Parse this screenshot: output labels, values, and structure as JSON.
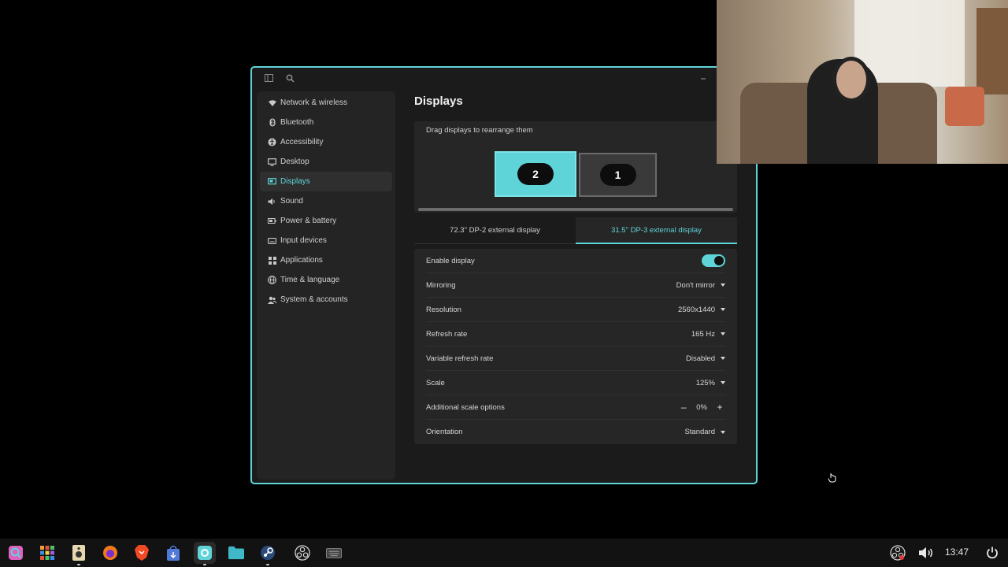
{
  "window": {
    "page_title": "Displays",
    "icons": {
      "sidebar_toggle": "sidebar-toggle-icon",
      "search": "search-icon",
      "minimize": "minimize-icon"
    }
  },
  "sidebar": {
    "items": [
      {
        "label": "Network & wireless",
        "icon": "wifi-icon"
      },
      {
        "label": "Bluetooth",
        "icon": "bluetooth-icon"
      },
      {
        "label": "Accessibility",
        "icon": "accessibility-icon"
      },
      {
        "label": "Desktop",
        "icon": "desktop-icon"
      },
      {
        "label": "Displays",
        "icon": "display-icon",
        "active": true
      },
      {
        "label": "Sound",
        "icon": "speaker-icon"
      },
      {
        "label": "Power & battery",
        "icon": "battery-icon"
      },
      {
        "label": "Input devices",
        "icon": "keyboard-icon"
      },
      {
        "label": "Applications",
        "icon": "apps-grid-icon"
      },
      {
        "label": "Time & language",
        "icon": "globe-icon"
      },
      {
        "label": "System & accounts",
        "icon": "users-icon"
      }
    ]
  },
  "arrange": {
    "hint": "Drag displays to rearrange them",
    "displays": [
      {
        "number": "2",
        "selected": true
      },
      {
        "number": "1",
        "selected": false
      }
    ]
  },
  "tabs": [
    {
      "label": "72.3\" DP-2 external display",
      "active": false
    },
    {
      "label": "31.5\" DP-3 external display",
      "active": true
    }
  ],
  "settings": {
    "enable_display": {
      "label": "Enable display",
      "on": true
    },
    "mirroring": {
      "label": "Mirroring",
      "value": "Don't mirror"
    },
    "resolution": {
      "label": "Resolution",
      "value": "2560x1440"
    },
    "refresh_rate": {
      "label": "Refresh rate",
      "value": "165 Hz"
    },
    "vrr": {
      "label": "Variable refresh rate",
      "value": "Disabled"
    },
    "scale": {
      "label": "Scale",
      "value": "125%"
    },
    "additional_scale": {
      "label": "Additional scale options",
      "minus": "–",
      "value": "0%",
      "plus": "+"
    },
    "orientation": {
      "label": "Orientation",
      "value": "Standard"
    }
  },
  "taskbar": {
    "clock": "13:47",
    "apps": [
      "launcher-icon",
      "app-grid-icon",
      "speaker-app-icon",
      "firefox-icon",
      "brave-icon",
      "store-icon",
      "settings-app-icon",
      "files-icon",
      "steam-icon",
      "obs-icon",
      "keyboard-app-icon"
    ],
    "tray": [
      "obs-tray-icon",
      "volume-icon",
      "power-icon"
    ]
  },
  "colors": {
    "accent": "#5fd4d8",
    "window_bg": "#1b1b1b",
    "panel_bg": "#262626"
  }
}
